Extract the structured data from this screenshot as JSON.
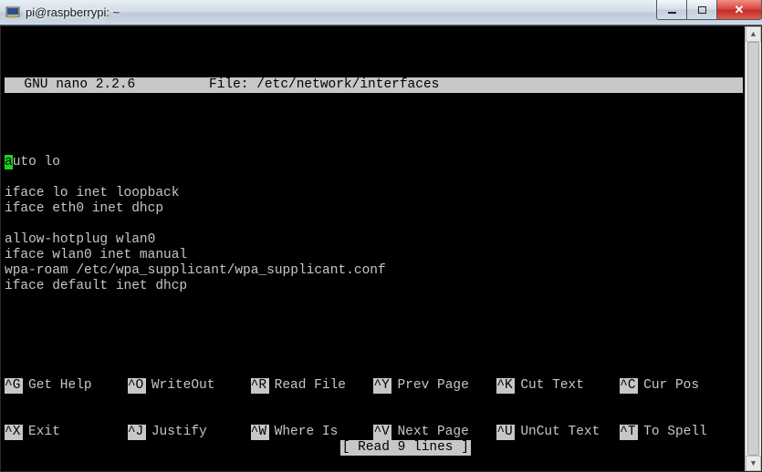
{
  "window": {
    "title": "pi@raspberrypi: ~"
  },
  "nano": {
    "app": "GNU nano",
    "version": "2.2.6",
    "file_label": "File:",
    "file_path": "/etc/network/interfaces",
    "status": "[ Read 9 lines ]",
    "lines": [
      "auto lo",
      "",
      "iface lo inet loopback",
      "iface eth0 inet dhcp",
      "",
      "allow-hotplug wlan0",
      "iface wlan0 inet manual",
      "wpa-roam /etc/wpa_supplicant/wpa_supplicant.conf",
      "iface default inet dhcp"
    ],
    "help_row1": [
      {
        "key": "^G",
        "label": "Get Help"
      },
      {
        "key": "^O",
        "label": "WriteOut"
      },
      {
        "key": "^R",
        "label": "Read File"
      },
      {
        "key": "^Y",
        "label": "Prev Page"
      },
      {
        "key": "^K",
        "label": "Cut Text"
      },
      {
        "key": "^C",
        "label": "Cur Pos"
      }
    ],
    "help_row2": [
      {
        "key": "^X",
        "label": "Exit"
      },
      {
        "key": "^J",
        "label": "Justify"
      },
      {
        "key": "^W",
        "label": "Where Is"
      },
      {
        "key": "^V",
        "label": "Next Page"
      },
      {
        "key": "^U",
        "label": "UnCut Text"
      },
      {
        "key": "^T",
        "label": "To Spell"
      }
    ]
  }
}
